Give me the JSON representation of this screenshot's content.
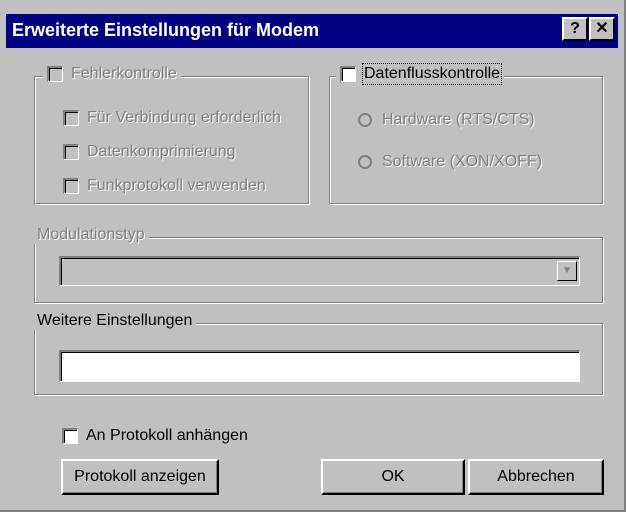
{
  "window": {
    "title": "Erweiterte Einstellungen für Modem",
    "help_btn": "?",
    "close_btn": "✕"
  },
  "error_control": {
    "label": "Fehlerkontrolle",
    "checked": false,
    "enabled": false,
    "options": [
      {
        "label": "Für Verbindung erforderlich",
        "checked": false
      },
      {
        "label": "Datenkomprimierung",
        "checked": false
      },
      {
        "label": "Funkprotokoll verwenden",
        "checked": false
      }
    ]
  },
  "flow_control": {
    "label": "Datenflusskontrolle",
    "checked": false,
    "options": [
      {
        "label": "Hardware (RTS/CTS)"
      },
      {
        "label": "Software (XON/XOFF)"
      }
    ]
  },
  "modulation": {
    "label": "Modulationstyp",
    "value": "",
    "arrow": "▼"
  },
  "extra_settings": {
    "label": "Weitere Einstellungen",
    "value": ""
  },
  "log": {
    "append_label": "An Protokoll anhängen",
    "append_checked": false
  },
  "buttons": {
    "view_log": "Protokoll anzeigen",
    "ok": "OK",
    "cancel": "Abbrechen"
  }
}
